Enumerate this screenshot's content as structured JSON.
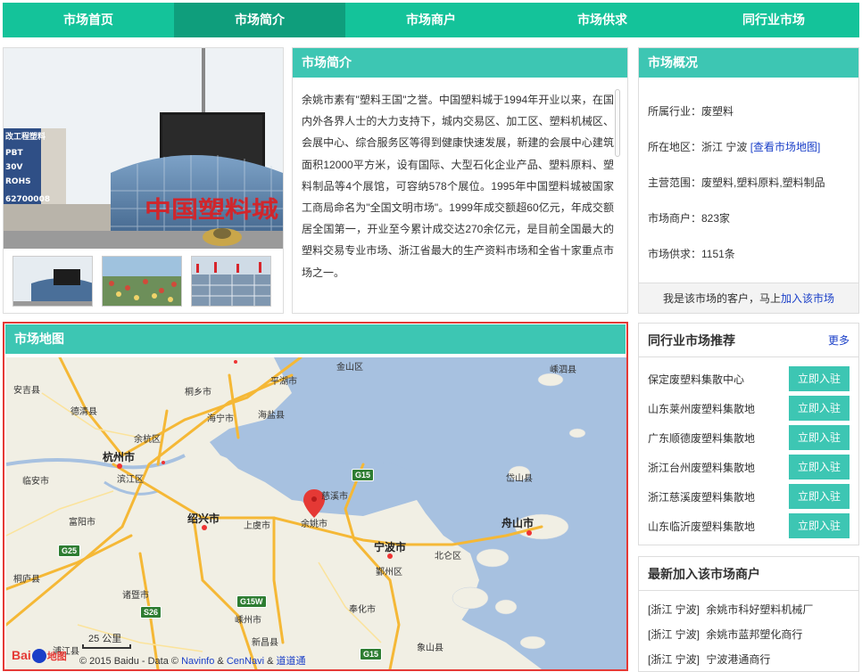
{
  "nav": {
    "items": [
      {
        "label": "市场首页"
      },
      {
        "label": "市场简介"
      },
      {
        "label": "市场商户"
      },
      {
        "label": "市场供求"
      },
      {
        "label": "同行业市场"
      }
    ]
  },
  "photo": {
    "sign_text": "中国塑料城",
    "board_lines": [
      "改工程塑料",
      "PBT",
      "30V",
      "ROHS",
      "62700008"
    ]
  },
  "intro": {
    "title": "市场简介",
    "text": "余姚市素有\"塑料王国\"之誉。中国塑料城于1994年开业以来，在国内外各界人士的大力支持下，城内交易区、加工区、塑料机械区、会展中心、综合服务区等得到健康快速发展，新建的会展中心建筑面积12000平方米，设有国际、大型石化企业产品、塑料原料、塑料制品等4个展馆，可容纳578个展位。1995年中国塑料城被国家工商局命名为\"全国文明市场\"。1999年成交额超60亿元，年成交额居全国第一，开业至今累计成交达270余亿元，是目前全国最大的塑料交易专业市场、浙江省最大的生产资料市场和全省十家重点市场之一。"
  },
  "overview": {
    "title": "市场概况",
    "industry": "所属行业：废塑料",
    "region": "所在地区：浙江 宁波",
    "map_link": "[查看市场地图]",
    "scope": "主营范围：废塑料,塑料原料,塑料制品",
    "merchants": "市场商户：823家",
    "supply": "市场供求：1151条",
    "footer_text": "我是该市场的客户，马上",
    "footer_link": "加入该市场"
  },
  "recommend": {
    "title": "同行业市场推荐",
    "more": "更多",
    "button_label": "立即入驻",
    "items": [
      {
        "name": "保定废塑料集散中心"
      },
      {
        "name": "山东莱州废塑料集散地"
      },
      {
        "name": "广东顺德废塑料集散地"
      },
      {
        "name": "浙江台州废塑料集散地"
      },
      {
        "name": "浙江慈溪废塑料集散地"
      },
      {
        "name": "山东临沂废塑料集散地"
      }
    ]
  },
  "newest": {
    "title": "最新加入该市场商户",
    "items": [
      {
        "region": "[浙江 宁波]",
        "name": "余姚市科好塑料机械厂"
      },
      {
        "region": "[浙江 宁波]",
        "name": "余姚市蓝邦塑化商行"
      },
      {
        "region": "[浙江 宁波]",
        "name": "宁波港通商行"
      }
    ]
  },
  "map": {
    "title": "市场地图",
    "cities": [
      "杭州市",
      "绍兴市",
      "宁波市",
      "舟山市"
    ],
    "places": [
      "金山区",
      "嵊泗县",
      "安吉县",
      "平湖市",
      "桐乡市",
      "德清县",
      "海宁市",
      "海盐县",
      "余杭区",
      "临安市",
      "滨江区",
      "富阳市",
      "慈溪市",
      "上虞市",
      "余姚市",
      "岱山县",
      "北仑区",
      "鄞州区",
      "桐庐县",
      "诸暨市",
      "嵊州市",
      "奉化市",
      "新昌县",
      "浦江县",
      "象山县"
    ],
    "highways": [
      "G15",
      "G25",
      "S26",
      "G15W",
      "G15"
    ],
    "scale": "25 公里",
    "logo_text": "Bai",
    "logo_text2": "地图",
    "copyright_pre": "© 2015 Baidu - Data ©",
    "copyright_navinfo": "Navinfo",
    "copyright_amp": "&",
    "copyright_cennavi": "CenNavi",
    "copyright_amp2": "&",
    "copyright_daodao": "道道通"
  },
  "colors": {
    "nav": "#14c39a",
    "nav_active": "#0f9e7c",
    "panel_header": "#3dc6b3",
    "button": "#3dc6b3",
    "highlight_border": "#e53935",
    "link": "#1a3fc8",
    "sea": "#a7c1e0",
    "land": "#f1efe4"
  }
}
